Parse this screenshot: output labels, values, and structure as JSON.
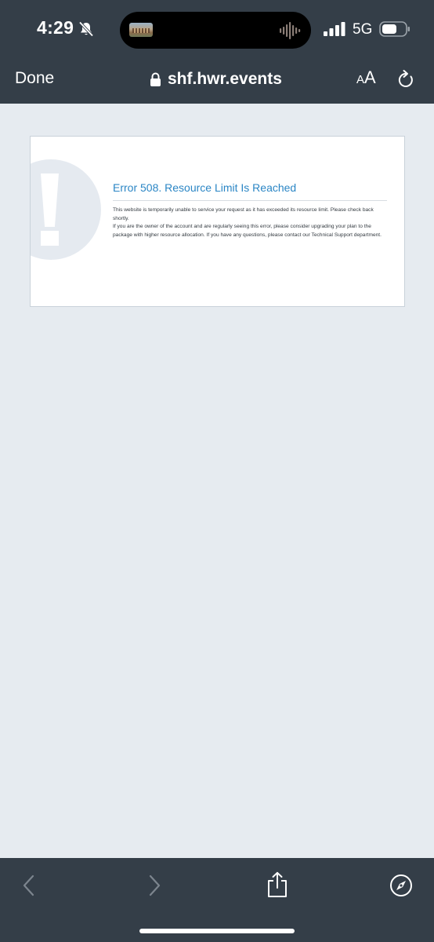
{
  "status_bar": {
    "time": "4:29",
    "network": "5G",
    "icons": [
      "bell-slash-icon",
      "waveform-icon",
      "signal-icon",
      "battery-icon"
    ]
  },
  "browser": {
    "done_label": "Done",
    "url": "shf.hwr.events",
    "reader_small": "A",
    "reader_big": "A",
    "icons": [
      "lock-icon",
      "reload-icon"
    ]
  },
  "page": {
    "error_title": "Error 508.  Resource Limit Is Reached",
    "paragraph_1": "This website is temporarily unable to service your request as it has exceeded its resource limit. Please check back shortly.",
    "paragraph_2": "If you are the owner of the account and are regularly seeing this error, please consider upgrading your plan to the package with higher resource allocation. If you have any questions, please contact our Technical Support department.",
    "icon": "exclamation-icon"
  },
  "toolbar": {
    "icons": [
      "back-icon",
      "forward-icon",
      "share-icon",
      "compass-icon"
    ]
  },
  "colors": {
    "chrome_background": "#343e48",
    "page_background": "#e6ebf0",
    "title_blue": "#2b86c5",
    "disabled_icon": "#7c858e"
  }
}
